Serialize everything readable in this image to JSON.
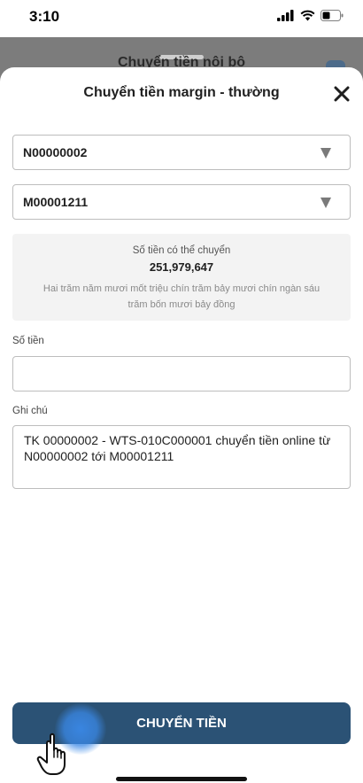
{
  "status_bar": {
    "time": "3:10"
  },
  "background_page": {
    "title": "Chuyển tiền nội bộ"
  },
  "sheet": {
    "title": "Chuyển tiền margin - thường",
    "from_account": "N00000002",
    "to_account": "M00001211",
    "available": {
      "label": "Số tiền có thể chuyển",
      "amount": "251,979,647",
      "in_words": "Hai trăm năm mươi mốt triệu chín trăm bảy mươi chín ngàn sáu trăm bốn mươi bảy đồng"
    },
    "amount_field": {
      "label": "Số tiền",
      "value": ""
    },
    "note_field": {
      "label": "Ghi chú",
      "value": "TK 00000002 - WTS-010C000001 chuyển tiền online từ N00000002 tới M00001211"
    },
    "submit_label": "CHUYỂN TIỀN"
  },
  "colors": {
    "primary_button": "#2b5275",
    "backdrop": "#7c7c7c",
    "info_box": "#f3f3f3",
    "touch_indicator": "#3a88e6"
  },
  "icons": [
    "signal-icon",
    "wifi-icon",
    "battery-icon",
    "close-icon",
    "dropdown-arrow-icon",
    "hand-pointer-icon"
  ]
}
